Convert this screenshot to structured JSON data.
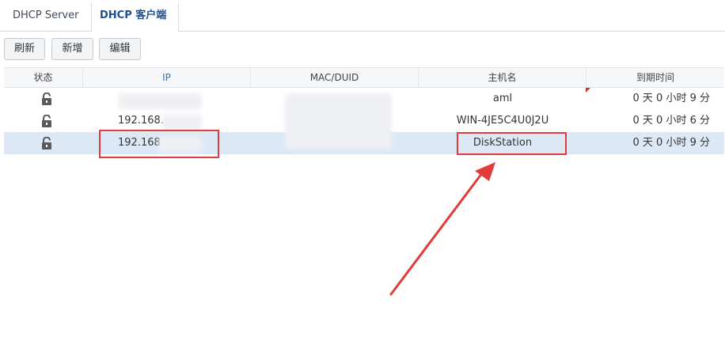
{
  "tabs": [
    {
      "label": "DHCP Server"
    },
    {
      "label": "DHCP 客户端"
    }
  ],
  "toolbar": {
    "refresh_label": "刷新",
    "add_label": "新增",
    "edit_label": "编辑"
  },
  "table": {
    "headers": [
      "状态",
      "IP",
      "MAC/DUID",
      "主机名",
      "到期时间"
    ],
    "rows": [
      {
        "status_icon": "unlock-icon",
        "ip": "",
        "mac": "",
        "host": "aml",
        "expire": "0 天 0 小时 9 分"
      },
      {
        "status_icon": "unlock-icon",
        "ip": "192.168.",
        "mac": "",
        "host": "WIN-4JE5C4U0J2U",
        "expire": "0 天 0 小时 6 分"
      },
      {
        "status_icon": "unlock-icon",
        "ip": "192.168",
        "mac": "",
        "host": "DiskStation",
        "expire": "0 天 0 小时 9 分"
      }
    ]
  },
  "annotations": {
    "highlight_color": "#e23b3b"
  }
}
